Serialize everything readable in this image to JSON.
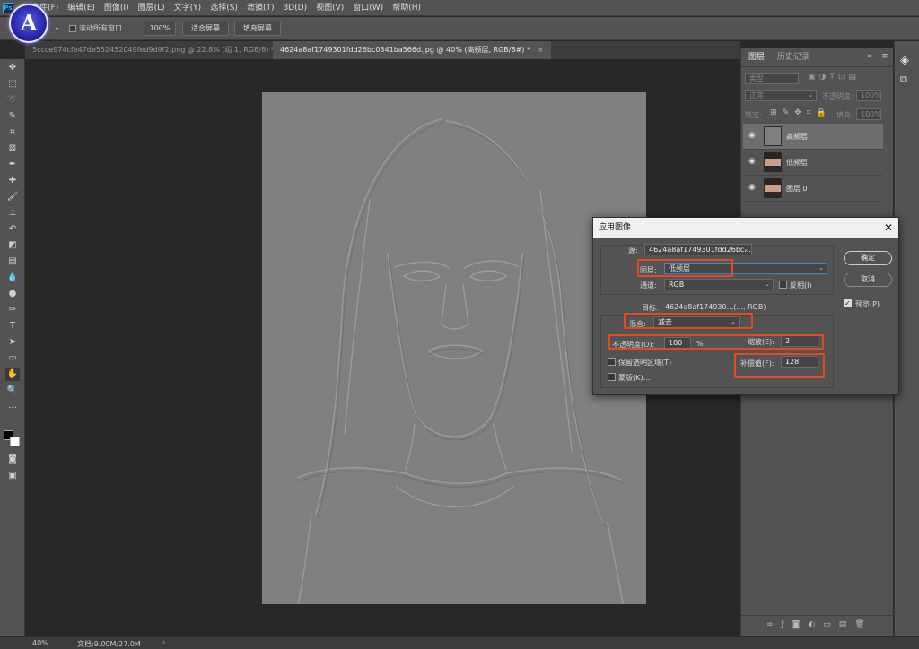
{
  "menu": [
    "文件(F)",
    "编辑(E)",
    "图像(I)",
    "图层(L)",
    "文字(Y)",
    "选择(S)",
    "滤镜(T)",
    "3D(D)",
    "视图(V)",
    "窗口(W)",
    "帮助(H)"
  ],
  "options": {
    "scroll_all": "滚动所有窗口",
    "zoom": "100%",
    "fit_screen": "适合屏幕",
    "fill_screen": "填充屏幕"
  },
  "tabs": [
    {
      "label": "5ccce974cfe47de552452049fed9d9f2.png @ 22.8% (组 1, RGB/8) *",
      "close": "×"
    },
    {
      "label": "4624a8af1749301fdd26bc0341ba566d.jpg @ 40% (高频层, RGB/8#) *",
      "close": "×"
    }
  ],
  "layers_panel": {
    "tab_layers": "图层",
    "tab_history": "历史记录",
    "filter_kind": "类型",
    "blend_mode": "正常",
    "opacity_label": "不透明度:",
    "opacity_value": "100%",
    "lock_label": "锁定:",
    "fill_label": "填充:",
    "fill_value": "100%",
    "layers": [
      {
        "name": "高频层"
      },
      {
        "name": "低频层"
      },
      {
        "name": "图层 0"
      }
    ]
  },
  "status": {
    "zoom": "40%",
    "doc": "文档:9.00M/27.0M"
  },
  "dialog": {
    "title": "应用图像",
    "source_label": "源:",
    "source_value": "4624a8af1749301fdd26bc...",
    "layer_label": "图层:",
    "layer_value": "低频层",
    "channel_label": "通道:",
    "channel_value": "RGB",
    "invert_label": "反相(I)",
    "target_label": "目标:",
    "target_value": "4624a8af174930...(..., RGB)",
    "blend_label": "混合:",
    "blend_value": "减去",
    "opacity_label": "不透明度(O):",
    "opacity_value": "100",
    "percent": "%",
    "scale_label": "缩放(E):",
    "scale_value": "2",
    "preserve_label": "保留透明区域(T)",
    "offset_label": "补偿值(F):",
    "offset_value": "128",
    "mask_label": "蒙版(K)...",
    "ok": "确定",
    "cancel": "取消",
    "preview": "预览(P)"
  }
}
